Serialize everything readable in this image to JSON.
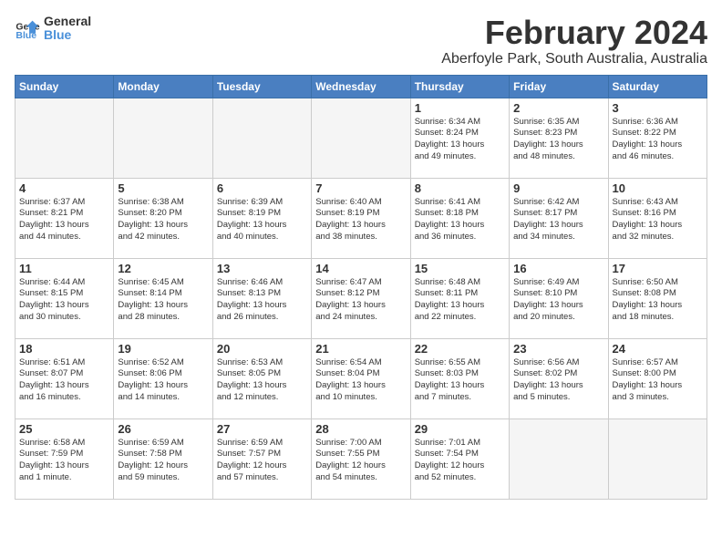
{
  "logo": {
    "line1": "General",
    "line2": "Blue"
  },
  "title": "February 2024",
  "subtitle": "Aberfoyle Park, South Australia, Australia",
  "days_header": [
    "Sunday",
    "Monday",
    "Tuesday",
    "Wednesday",
    "Thursday",
    "Friday",
    "Saturday"
  ],
  "weeks": [
    [
      {
        "num": "",
        "info": "",
        "empty": true
      },
      {
        "num": "",
        "info": "",
        "empty": true
      },
      {
        "num": "",
        "info": "",
        "empty": true
      },
      {
        "num": "",
        "info": "",
        "empty": true
      },
      {
        "num": "1",
        "info": "Sunrise: 6:34 AM\nSunset: 8:24 PM\nDaylight: 13 hours\nand 49 minutes."
      },
      {
        "num": "2",
        "info": "Sunrise: 6:35 AM\nSunset: 8:23 PM\nDaylight: 13 hours\nand 48 minutes."
      },
      {
        "num": "3",
        "info": "Sunrise: 6:36 AM\nSunset: 8:22 PM\nDaylight: 13 hours\nand 46 minutes."
      }
    ],
    [
      {
        "num": "4",
        "info": "Sunrise: 6:37 AM\nSunset: 8:21 PM\nDaylight: 13 hours\nand 44 minutes."
      },
      {
        "num": "5",
        "info": "Sunrise: 6:38 AM\nSunset: 8:20 PM\nDaylight: 13 hours\nand 42 minutes."
      },
      {
        "num": "6",
        "info": "Sunrise: 6:39 AM\nSunset: 8:19 PM\nDaylight: 13 hours\nand 40 minutes."
      },
      {
        "num": "7",
        "info": "Sunrise: 6:40 AM\nSunset: 8:19 PM\nDaylight: 13 hours\nand 38 minutes."
      },
      {
        "num": "8",
        "info": "Sunrise: 6:41 AM\nSunset: 8:18 PM\nDaylight: 13 hours\nand 36 minutes."
      },
      {
        "num": "9",
        "info": "Sunrise: 6:42 AM\nSunset: 8:17 PM\nDaylight: 13 hours\nand 34 minutes."
      },
      {
        "num": "10",
        "info": "Sunrise: 6:43 AM\nSunset: 8:16 PM\nDaylight: 13 hours\nand 32 minutes."
      }
    ],
    [
      {
        "num": "11",
        "info": "Sunrise: 6:44 AM\nSunset: 8:15 PM\nDaylight: 13 hours\nand 30 minutes."
      },
      {
        "num": "12",
        "info": "Sunrise: 6:45 AM\nSunset: 8:14 PM\nDaylight: 13 hours\nand 28 minutes."
      },
      {
        "num": "13",
        "info": "Sunrise: 6:46 AM\nSunset: 8:13 PM\nDaylight: 13 hours\nand 26 minutes."
      },
      {
        "num": "14",
        "info": "Sunrise: 6:47 AM\nSunset: 8:12 PM\nDaylight: 13 hours\nand 24 minutes."
      },
      {
        "num": "15",
        "info": "Sunrise: 6:48 AM\nSunset: 8:11 PM\nDaylight: 13 hours\nand 22 minutes."
      },
      {
        "num": "16",
        "info": "Sunrise: 6:49 AM\nSunset: 8:10 PM\nDaylight: 13 hours\nand 20 minutes."
      },
      {
        "num": "17",
        "info": "Sunrise: 6:50 AM\nSunset: 8:08 PM\nDaylight: 13 hours\nand 18 minutes."
      }
    ],
    [
      {
        "num": "18",
        "info": "Sunrise: 6:51 AM\nSunset: 8:07 PM\nDaylight: 13 hours\nand 16 minutes."
      },
      {
        "num": "19",
        "info": "Sunrise: 6:52 AM\nSunset: 8:06 PM\nDaylight: 13 hours\nand 14 minutes."
      },
      {
        "num": "20",
        "info": "Sunrise: 6:53 AM\nSunset: 8:05 PM\nDaylight: 13 hours\nand 12 minutes."
      },
      {
        "num": "21",
        "info": "Sunrise: 6:54 AM\nSunset: 8:04 PM\nDaylight: 13 hours\nand 10 minutes."
      },
      {
        "num": "22",
        "info": "Sunrise: 6:55 AM\nSunset: 8:03 PM\nDaylight: 13 hours\nand 7 minutes."
      },
      {
        "num": "23",
        "info": "Sunrise: 6:56 AM\nSunset: 8:02 PM\nDaylight: 13 hours\nand 5 minutes."
      },
      {
        "num": "24",
        "info": "Sunrise: 6:57 AM\nSunset: 8:00 PM\nDaylight: 13 hours\nand 3 minutes."
      }
    ],
    [
      {
        "num": "25",
        "info": "Sunrise: 6:58 AM\nSunset: 7:59 PM\nDaylight: 13 hours\nand 1 minute."
      },
      {
        "num": "26",
        "info": "Sunrise: 6:59 AM\nSunset: 7:58 PM\nDaylight: 12 hours\nand 59 minutes."
      },
      {
        "num": "27",
        "info": "Sunrise: 6:59 AM\nSunset: 7:57 PM\nDaylight: 12 hours\nand 57 minutes."
      },
      {
        "num": "28",
        "info": "Sunrise: 7:00 AM\nSunset: 7:55 PM\nDaylight: 12 hours\nand 54 minutes."
      },
      {
        "num": "29",
        "info": "Sunrise: 7:01 AM\nSunset: 7:54 PM\nDaylight: 12 hours\nand 52 minutes."
      },
      {
        "num": "",
        "info": "",
        "empty": true
      },
      {
        "num": "",
        "info": "",
        "empty": true
      }
    ]
  ]
}
